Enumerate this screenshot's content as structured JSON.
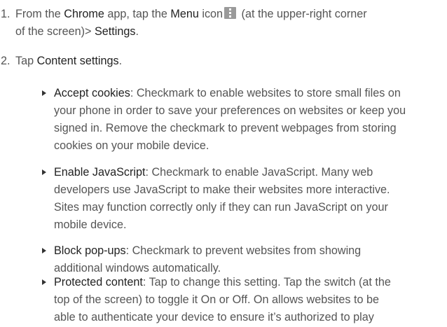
{
  "steps": [
    {
      "num": "1.",
      "line1_a": "From the ",
      "line1_b": "Chrome",
      "line1_c": " app, tap the ",
      "line1_d": "Menu",
      "line1_e": " icon",
      "line1_f": " (at the upper-right corner",
      "line2_a": "of the screen)> ",
      "line2_b": "Settings",
      "line2_c": "."
    },
    {
      "num": "2.",
      "text_a": "Tap ",
      "text_b": "Content settings",
      "text_c": "."
    }
  ],
  "bullets": [
    {
      "term": "Accept cookies",
      "lines": [
        ": Checkmark to enable websites to store small files on",
        "your phone in order to save your preferences on websites or keep you",
        "signed in. Remove the checkmark to prevent webpages from storing",
        "cookies on your mobile device."
      ]
    },
    {
      "term": "Enable JavaScript",
      "lines": [
        ": Checkmark to enable JavaScript. Many web",
        "developers use JavaScript to make their websites more interactive.",
        "Sites may function correctly only if they can run JavaScript on your",
        "mobile device."
      ]
    },
    {
      "term": "Block pop-ups",
      "lines": [
        ": Checkmark to prevent websites from showing",
        "additional windows automatically."
      ]
    },
    {
      "term": "Protected content",
      "lines": [
        ": Tap to change this setting. Tap the switch (at the",
        "top of the screen) to toggle it On or Off. On allows websites to be",
        "able to authenticate your device to ensure it’s authorized to play"
      ]
    }
  ],
  "icons": {
    "menu": "menu-icon"
  },
  "colors": {
    "text": "#555555",
    "keyword": "#222222",
    "icon_bg": "#9a9a9a"
  }
}
